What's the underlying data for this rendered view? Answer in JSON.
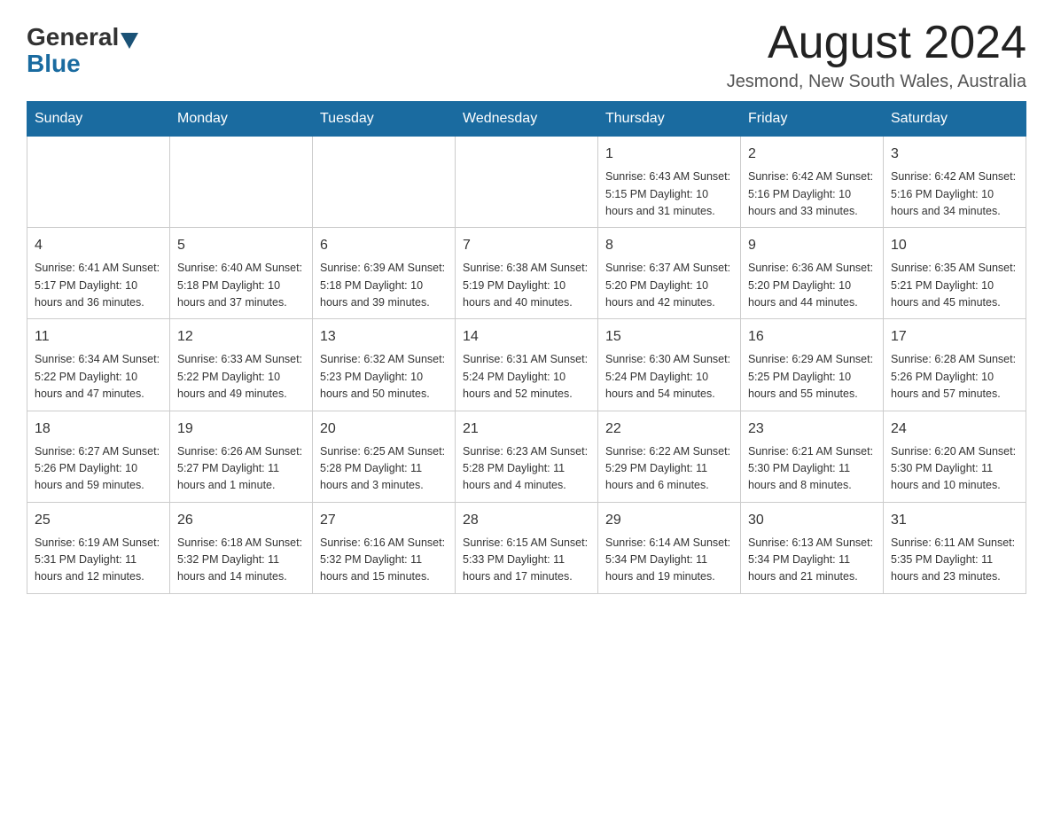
{
  "header": {
    "logo_general": "General",
    "logo_blue": "Blue",
    "month_year": "August 2024",
    "location": "Jesmond, New South Wales, Australia"
  },
  "weekdays": [
    "Sunday",
    "Monday",
    "Tuesday",
    "Wednesday",
    "Thursday",
    "Friday",
    "Saturday"
  ],
  "weeks": [
    [
      {
        "day": "",
        "info": ""
      },
      {
        "day": "",
        "info": ""
      },
      {
        "day": "",
        "info": ""
      },
      {
        "day": "",
        "info": ""
      },
      {
        "day": "1",
        "info": "Sunrise: 6:43 AM\nSunset: 5:15 PM\nDaylight: 10 hours and 31 minutes."
      },
      {
        "day": "2",
        "info": "Sunrise: 6:42 AM\nSunset: 5:16 PM\nDaylight: 10 hours and 33 minutes."
      },
      {
        "day": "3",
        "info": "Sunrise: 6:42 AM\nSunset: 5:16 PM\nDaylight: 10 hours and 34 minutes."
      }
    ],
    [
      {
        "day": "4",
        "info": "Sunrise: 6:41 AM\nSunset: 5:17 PM\nDaylight: 10 hours and 36 minutes."
      },
      {
        "day": "5",
        "info": "Sunrise: 6:40 AM\nSunset: 5:18 PM\nDaylight: 10 hours and 37 minutes."
      },
      {
        "day": "6",
        "info": "Sunrise: 6:39 AM\nSunset: 5:18 PM\nDaylight: 10 hours and 39 minutes."
      },
      {
        "day": "7",
        "info": "Sunrise: 6:38 AM\nSunset: 5:19 PM\nDaylight: 10 hours and 40 minutes."
      },
      {
        "day": "8",
        "info": "Sunrise: 6:37 AM\nSunset: 5:20 PM\nDaylight: 10 hours and 42 minutes."
      },
      {
        "day": "9",
        "info": "Sunrise: 6:36 AM\nSunset: 5:20 PM\nDaylight: 10 hours and 44 minutes."
      },
      {
        "day": "10",
        "info": "Sunrise: 6:35 AM\nSunset: 5:21 PM\nDaylight: 10 hours and 45 minutes."
      }
    ],
    [
      {
        "day": "11",
        "info": "Sunrise: 6:34 AM\nSunset: 5:22 PM\nDaylight: 10 hours and 47 minutes."
      },
      {
        "day": "12",
        "info": "Sunrise: 6:33 AM\nSunset: 5:22 PM\nDaylight: 10 hours and 49 minutes."
      },
      {
        "day": "13",
        "info": "Sunrise: 6:32 AM\nSunset: 5:23 PM\nDaylight: 10 hours and 50 minutes."
      },
      {
        "day": "14",
        "info": "Sunrise: 6:31 AM\nSunset: 5:24 PM\nDaylight: 10 hours and 52 minutes."
      },
      {
        "day": "15",
        "info": "Sunrise: 6:30 AM\nSunset: 5:24 PM\nDaylight: 10 hours and 54 minutes."
      },
      {
        "day": "16",
        "info": "Sunrise: 6:29 AM\nSunset: 5:25 PM\nDaylight: 10 hours and 55 minutes."
      },
      {
        "day": "17",
        "info": "Sunrise: 6:28 AM\nSunset: 5:26 PM\nDaylight: 10 hours and 57 minutes."
      }
    ],
    [
      {
        "day": "18",
        "info": "Sunrise: 6:27 AM\nSunset: 5:26 PM\nDaylight: 10 hours and 59 minutes."
      },
      {
        "day": "19",
        "info": "Sunrise: 6:26 AM\nSunset: 5:27 PM\nDaylight: 11 hours and 1 minute."
      },
      {
        "day": "20",
        "info": "Sunrise: 6:25 AM\nSunset: 5:28 PM\nDaylight: 11 hours and 3 minutes."
      },
      {
        "day": "21",
        "info": "Sunrise: 6:23 AM\nSunset: 5:28 PM\nDaylight: 11 hours and 4 minutes."
      },
      {
        "day": "22",
        "info": "Sunrise: 6:22 AM\nSunset: 5:29 PM\nDaylight: 11 hours and 6 minutes."
      },
      {
        "day": "23",
        "info": "Sunrise: 6:21 AM\nSunset: 5:30 PM\nDaylight: 11 hours and 8 minutes."
      },
      {
        "day": "24",
        "info": "Sunrise: 6:20 AM\nSunset: 5:30 PM\nDaylight: 11 hours and 10 minutes."
      }
    ],
    [
      {
        "day": "25",
        "info": "Sunrise: 6:19 AM\nSunset: 5:31 PM\nDaylight: 11 hours and 12 minutes."
      },
      {
        "day": "26",
        "info": "Sunrise: 6:18 AM\nSunset: 5:32 PM\nDaylight: 11 hours and 14 minutes."
      },
      {
        "day": "27",
        "info": "Sunrise: 6:16 AM\nSunset: 5:32 PM\nDaylight: 11 hours and 15 minutes."
      },
      {
        "day": "28",
        "info": "Sunrise: 6:15 AM\nSunset: 5:33 PM\nDaylight: 11 hours and 17 minutes."
      },
      {
        "day": "29",
        "info": "Sunrise: 6:14 AM\nSunset: 5:34 PM\nDaylight: 11 hours and 19 minutes."
      },
      {
        "day": "30",
        "info": "Sunrise: 6:13 AM\nSunset: 5:34 PM\nDaylight: 11 hours and 21 minutes."
      },
      {
        "day": "31",
        "info": "Sunrise: 6:11 AM\nSunset: 5:35 PM\nDaylight: 11 hours and 23 minutes."
      }
    ]
  ]
}
